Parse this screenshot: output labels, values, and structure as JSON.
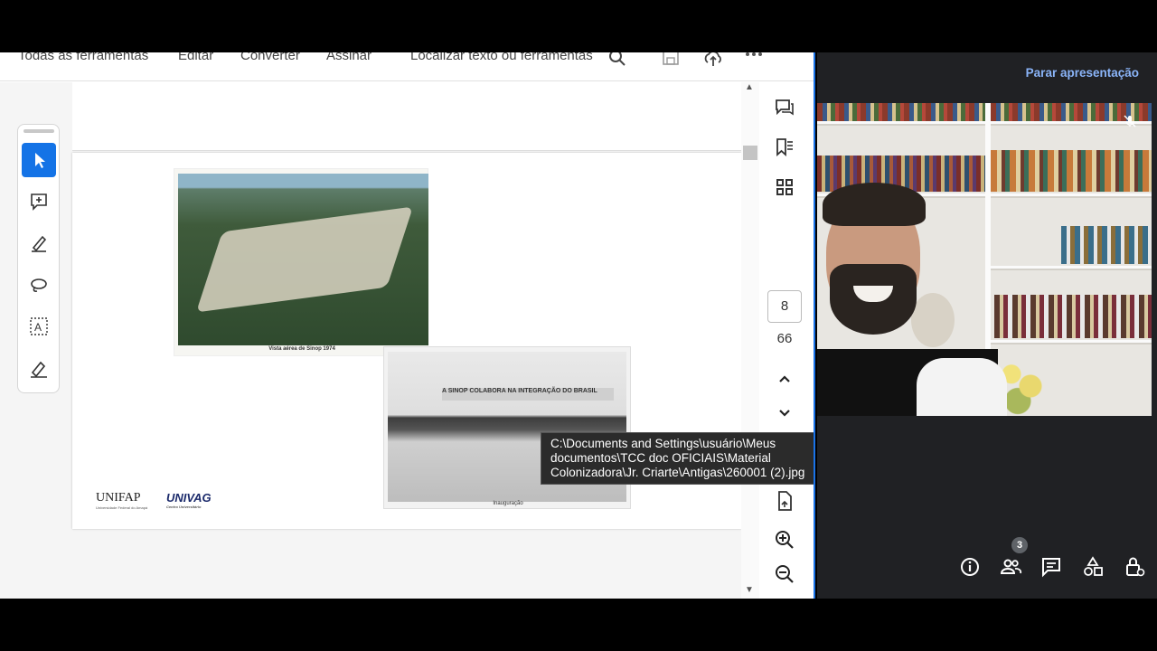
{
  "viewer": {
    "menu": [
      "Todas as ferramentas",
      "Editar",
      "Converter",
      "Assinar"
    ],
    "search_label": "Localizar texto ou ferramentas",
    "page_current": "8",
    "page_total": "66",
    "tooltip": "C:\\Documents and Settings\\usuário\\Meus documentos\\TCC doc OFICIAIS\\Material Colonizadora\\Jr. Criarte\\Antigas\\260001 (2).jpg",
    "photo1_caption": "Vista aérea de Sinop 1974",
    "photo2_caption": "Inauguração",
    "photo2_banner": "A SINOP COLABORA NA INTEGRAÇÃO DO BRASIL",
    "logo_unifap": "UNIFAP",
    "logo_unifap_sub": "Universidade Federal do Amapá",
    "logo_univag": "UNIVAG",
    "logo_univag_sub": "Centro Universitário"
  },
  "meet": {
    "stop_presenting": "Parar apresentação",
    "participants_count": "3"
  },
  "icons": {
    "tools": [
      "cursor-icon",
      "add-comment-icon",
      "highlight-pen-icon",
      "lasso-draw-icon",
      "text-select-icon",
      "signature-icon"
    ],
    "rail": [
      "comments-icon",
      "bookmarks-icon",
      "thumbnails-icon",
      "chevron-up-icon",
      "chevron-down-icon",
      "file-export-icon",
      "zoom-in-icon",
      "zoom-out-icon"
    ],
    "meet_controls": [
      "info-icon",
      "people-icon",
      "chat-icon",
      "activities-icon",
      "host-controls-icon"
    ]
  },
  "colors": {
    "accent": "#1473e6",
    "meet_bg": "#202124",
    "meet_link": "#8ab4f8"
  }
}
